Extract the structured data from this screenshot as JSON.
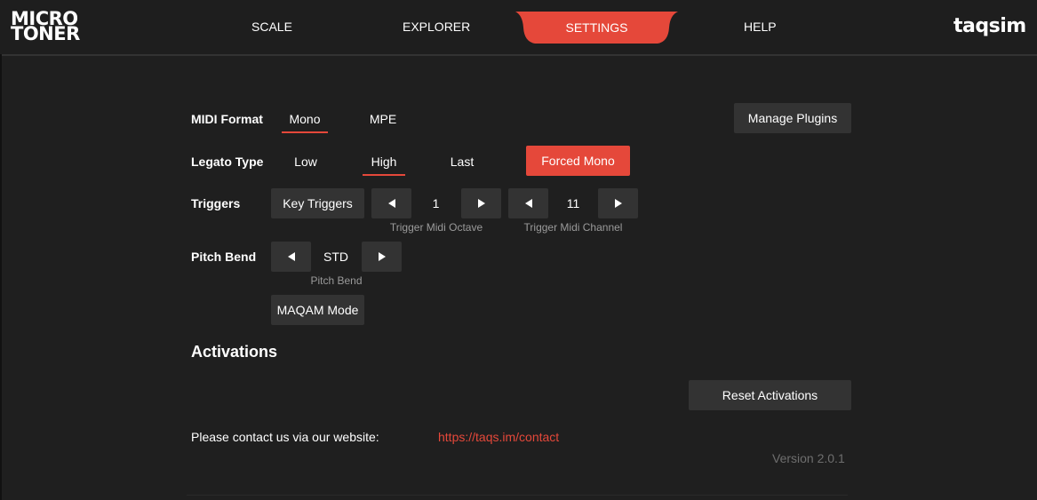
{
  "logo": {
    "line1": "MICRO",
    "line2": "TONER"
  },
  "brand": "taqsim",
  "tabs": {
    "scale": "SCALE",
    "explorer": "EXPLORER",
    "settings": "SETTINGS",
    "help": "HELP"
  },
  "colors": {
    "accent": "#e5483a",
    "background": "#1f1f1f",
    "button": "#333333"
  },
  "settings": {
    "midi_format": {
      "label": "MIDI Format",
      "options": [
        "Mono",
        "MPE"
      ],
      "selected": "Mono"
    },
    "manage_plugins": "Manage Plugins",
    "legato_type": {
      "label": "Legato Type",
      "options": [
        "Low",
        "High",
        "Last"
      ],
      "selected": "High",
      "forced_mono": "Forced Mono"
    },
    "triggers": {
      "label": "Triggers",
      "key_triggers": "Key Triggers",
      "octave_value": "1",
      "octave_caption": "Trigger Midi Octave",
      "channel_value": "11",
      "channel_caption": "Trigger Midi Channel"
    },
    "pitch_bend": {
      "label": "Pitch Bend",
      "value": "STD",
      "caption": "Pitch Bend"
    },
    "maqam_mode": "MAQAM Mode"
  },
  "activations": {
    "heading": "Activations",
    "reset": "Reset Activations",
    "contact_text": "Please contact us via our website:",
    "contact_link": "https://taqs.im/contact",
    "version": "Version 2.0.1"
  },
  "icons": {
    "left": "triangle-left-icon",
    "right": "triangle-right-icon"
  }
}
